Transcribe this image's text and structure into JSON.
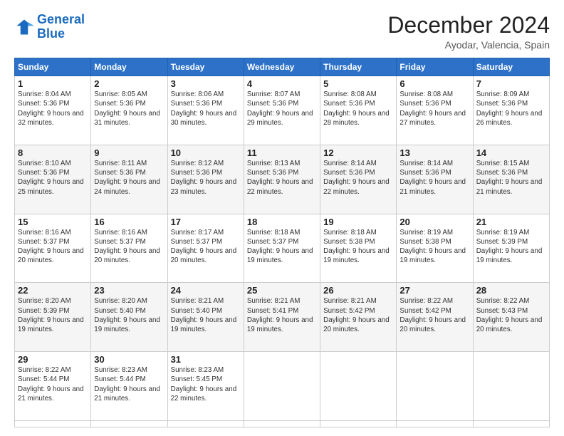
{
  "logo": {
    "line1": "General",
    "line2": "Blue"
  },
  "header": {
    "title": "December 2024",
    "subtitle": "Ayodar, Valencia, Spain"
  },
  "weekdays": [
    "Sunday",
    "Monday",
    "Tuesday",
    "Wednesday",
    "Thursday",
    "Friday",
    "Saturday"
  ],
  "days": [
    {
      "num": "1",
      "sunrise": "Sunrise: 8:04 AM",
      "sunset": "Sunset: 5:36 PM",
      "daylight": "Daylight: 9 hours and 32 minutes."
    },
    {
      "num": "2",
      "sunrise": "Sunrise: 8:05 AM",
      "sunset": "Sunset: 5:36 PM",
      "daylight": "Daylight: 9 hours and 31 minutes."
    },
    {
      "num": "3",
      "sunrise": "Sunrise: 8:06 AM",
      "sunset": "Sunset: 5:36 PM",
      "daylight": "Daylight: 9 hours and 30 minutes."
    },
    {
      "num": "4",
      "sunrise": "Sunrise: 8:07 AM",
      "sunset": "Sunset: 5:36 PM",
      "daylight": "Daylight: 9 hours and 29 minutes."
    },
    {
      "num": "5",
      "sunrise": "Sunrise: 8:08 AM",
      "sunset": "Sunset: 5:36 PM",
      "daylight": "Daylight: 9 hours and 28 minutes."
    },
    {
      "num": "6",
      "sunrise": "Sunrise: 8:08 AM",
      "sunset": "Sunset: 5:36 PM",
      "daylight": "Daylight: 9 hours and 27 minutes."
    },
    {
      "num": "7",
      "sunrise": "Sunrise: 8:09 AM",
      "sunset": "Sunset: 5:36 PM",
      "daylight": "Daylight: 9 hours and 26 minutes."
    },
    {
      "num": "8",
      "sunrise": "Sunrise: 8:10 AM",
      "sunset": "Sunset: 5:36 PM",
      "daylight": "Daylight: 9 hours and 25 minutes."
    },
    {
      "num": "9",
      "sunrise": "Sunrise: 8:11 AM",
      "sunset": "Sunset: 5:36 PM",
      "daylight": "Daylight: 9 hours and 24 minutes."
    },
    {
      "num": "10",
      "sunrise": "Sunrise: 8:12 AM",
      "sunset": "Sunset: 5:36 PM",
      "daylight": "Daylight: 9 hours and 23 minutes."
    },
    {
      "num": "11",
      "sunrise": "Sunrise: 8:13 AM",
      "sunset": "Sunset: 5:36 PM",
      "daylight": "Daylight: 9 hours and 22 minutes."
    },
    {
      "num": "12",
      "sunrise": "Sunrise: 8:14 AM",
      "sunset": "Sunset: 5:36 PM",
      "daylight": "Daylight: 9 hours and 22 minutes."
    },
    {
      "num": "13",
      "sunrise": "Sunrise: 8:14 AM",
      "sunset": "Sunset: 5:36 PM",
      "daylight": "Daylight: 9 hours and 21 minutes."
    },
    {
      "num": "14",
      "sunrise": "Sunrise: 8:15 AM",
      "sunset": "Sunset: 5:36 PM",
      "daylight": "Daylight: 9 hours and 21 minutes."
    },
    {
      "num": "15",
      "sunrise": "Sunrise: 8:16 AM",
      "sunset": "Sunset: 5:37 PM",
      "daylight": "Daylight: 9 hours and 20 minutes."
    },
    {
      "num": "16",
      "sunrise": "Sunrise: 8:16 AM",
      "sunset": "Sunset: 5:37 PM",
      "daylight": "Daylight: 9 hours and 20 minutes."
    },
    {
      "num": "17",
      "sunrise": "Sunrise: 8:17 AM",
      "sunset": "Sunset: 5:37 PM",
      "daylight": "Daylight: 9 hours and 20 minutes."
    },
    {
      "num": "18",
      "sunrise": "Sunrise: 8:18 AM",
      "sunset": "Sunset: 5:37 PM",
      "daylight": "Daylight: 9 hours and 19 minutes."
    },
    {
      "num": "19",
      "sunrise": "Sunrise: 8:18 AM",
      "sunset": "Sunset: 5:38 PM",
      "daylight": "Daylight: 9 hours and 19 minutes."
    },
    {
      "num": "20",
      "sunrise": "Sunrise: 8:19 AM",
      "sunset": "Sunset: 5:38 PM",
      "daylight": "Daylight: 9 hours and 19 minutes."
    },
    {
      "num": "21",
      "sunrise": "Sunrise: 8:19 AM",
      "sunset": "Sunset: 5:39 PM",
      "daylight": "Daylight: 9 hours and 19 minutes."
    },
    {
      "num": "22",
      "sunrise": "Sunrise: 8:20 AM",
      "sunset": "Sunset: 5:39 PM",
      "daylight": "Daylight: 9 hours and 19 minutes."
    },
    {
      "num": "23",
      "sunrise": "Sunrise: 8:20 AM",
      "sunset": "Sunset: 5:40 PM",
      "daylight": "Daylight: 9 hours and 19 minutes."
    },
    {
      "num": "24",
      "sunrise": "Sunrise: 8:21 AM",
      "sunset": "Sunset: 5:40 PM",
      "daylight": "Daylight: 9 hours and 19 minutes."
    },
    {
      "num": "25",
      "sunrise": "Sunrise: 8:21 AM",
      "sunset": "Sunset: 5:41 PM",
      "daylight": "Daylight: 9 hours and 19 minutes."
    },
    {
      "num": "26",
      "sunrise": "Sunrise: 8:21 AM",
      "sunset": "Sunset: 5:42 PM",
      "daylight": "Daylight: 9 hours and 20 minutes."
    },
    {
      "num": "27",
      "sunrise": "Sunrise: 8:22 AM",
      "sunset": "Sunset: 5:42 PM",
      "daylight": "Daylight: 9 hours and 20 minutes."
    },
    {
      "num": "28",
      "sunrise": "Sunrise: 8:22 AM",
      "sunset": "Sunset: 5:43 PM",
      "daylight": "Daylight: 9 hours and 20 minutes."
    },
    {
      "num": "29",
      "sunrise": "Sunrise: 8:22 AM",
      "sunset": "Sunset: 5:44 PM",
      "daylight": "Daylight: 9 hours and 21 minutes."
    },
    {
      "num": "30",
      "sunrise": "Sunrise: 8:23 AM",
      "sunset": "Sunset: 5:44 PM",
      "daylight": "Daylight: 9 hours and 21 minutes."
    },
    {
      "num": "31",
      "sunrise": "Sunrise: 8:23 AM",
      "sunset": "Sunset: 5:45 PM",
      "daylight": "Daylight: 9 hours and 22 minutes."
    }
  ]
}
